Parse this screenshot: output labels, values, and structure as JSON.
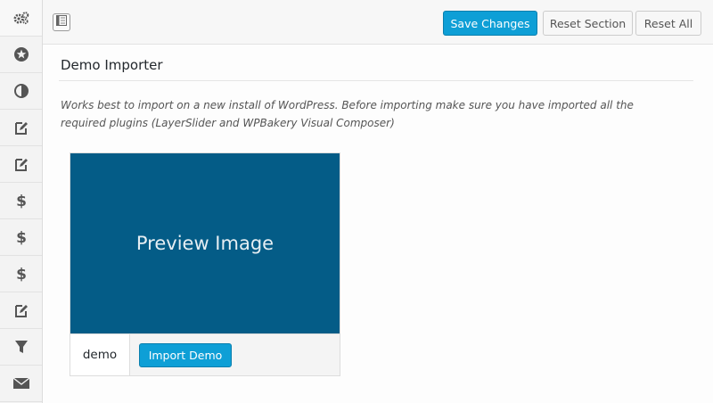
{
  "sidebar": {
    "items": [
      {
        "icon": "gears-icon"
      },
      {
        "icon": "star-icon"
      },
      {
        "icon": "contrast-icon"
      },
      {
        "icon": "edit-icon"
      },
      {
        "icon": "edit-icon"
      },
      {
        "icon": "dollar-icon"
      },
      {
        "icon": "dollar-icon"
      },
      {
        "icon": "dollar-icon"
      },
      {
        "icon": "edit-icon"
      },
      {
        "icon": "filter-icon"
      },
      {
        "icon": "envelope-icon"
      }
    ]
  },
  "toolbar": {
    "save_label": "Save Changes",
    "reset_section_label": "Reset Section",
    "reset_all_label": "Reset All"
  },
  "section": {
    "title": "Demo Importer",
    "description_line1": "Works best to import on a new install of WordPress. Before importing make sure you have imported all the",
    "description_line2": "required plugins (LayerSlider and WPBakery Visual Composer)"
  },
  "demo": {
    "preview_text": "Preview Image",
    "name": "demo",
    "import_label": "Import Demo"
  },
  "colors": {
    "accent": "#0e9fd6",
    "preview_bg": "#045c87"
  }
}
